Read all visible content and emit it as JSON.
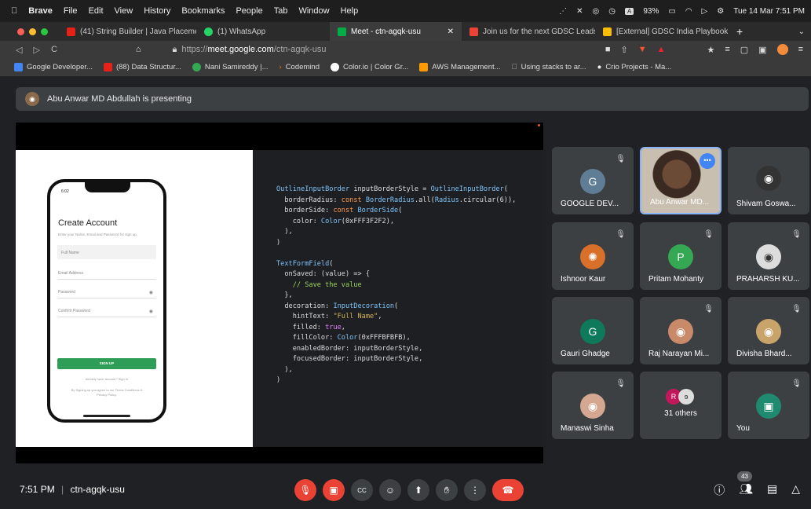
{
  "menubar": {
    "browser": "Brave",
    "items": [
      "File",
      "Edit",
      "View",
      "History",
      "Bookmarks",
      "People",
      "Tab",
      "Window",
      "Help"
    ],
    "battery": "93%",
    "datetime": "Tue 14 Mar 7:51 PM"
  },
  "tabs": [
    {
      "label": "(41) String Builder | Java Placemen",
      "color": "#e62117"
    },
    {
      "label": "(1) WhatsApp",
      "color": "#25d366"
    },
    {
      "label": "Meet - ctn-agqk-usu",
      "color": "#00ac47",
      "active": true
    },
    {
      "label": "Join us for the next GDSC Leads Sy",
      "color": "#ea4335"
    },
    {
      "label": "[External] GDSC India Playbook 20:",
      "color": "#fbbc04"
    }
  ],
  "address": {
    "scheme": "https://",
    "host": "meet.google.com",
    "path": "/ctn-agqk-usu"
  },
  "bookmarks": [
    {
      "label": "Google Developer...",
      "color": "#4285f4"
    },
    {
      "label": "(88) Data Structur...",
      "color": "#e62117"
    },
    {
      "label": "Nani Samireddy |...",
      "color": "#34a853"
    },
    {
      "label": "Codemind",
      "color": "#f26522"
    },
    {
      "label": "Color.io | Color Gr...",
      "color": "#ffffff"
    },
    {
      "label": "AWS Management...",
      "color": "#ff9900"
    },
    {
      "label": "Using stacks to ar...",
      "color": "#888888"
    },
    {
      "label": "Crio Projects - Ma...",
      "color": "#dddddd"
    }
  ],
  "presenting": {
    "name": "Abu Anwar MD Abdullah is presenting"
  },
  "phone": {
    "time": "6:02",
    "title": "Create Account",
    "subtitle": "Enter your Name, Email and Password for sign up.",
    "fields": [
      "Full Name",
      "Email Address",
      "Password",
      "Confirm Password"
    ],
    "button": "SIGN UP",
    "login": "Already have account? Sign In",
    "terms": "By Signing up you agree to our Terms Conditions & Privacy Policy."
  },
  "code": {
    "l1a": "OutlineInputBorder",
    "l1b": " inputBorderStyle = ",
    "l1c": "OutlineInputBorder",
    "l1d": "(",
    "l2a": "  borderRadius: ",
    "l2b": "const ",
    "l2c": "BorderRadius",
    "l2d": ".all(",
    "l2e": "Radius",
    "l2f": ".circular(6)),",
    "l3a": "  borderSide: ",
    "l3b": "const ",
    "l3c": "BorderSide",
    "l3d": "(",
    "l4a": "    color: ",
    "l4b": "Color",
    "l4c": "(0xFFF3F2F2),",
    "l5": "  ),",
    "l6": ")",
    "l7": "",
    "l8a": "TextFormField",
    "l8b": "(",
    "l9a": "  onSaved: (value) => {",
    "l10": "    // Save the value",
    "l11": "  },",
    "l12a": "  decoration: ",
    "l12b": "InputDecoration",
    "l12c": "(",
    "l13a": "    hintText: ",
    "l13b": "\"Full Name\"",
    "l13c": ",",
    "l14a": "    filled: ",
    "l14b": "true",
    "l14c": ",",
    "l15a": "    fillColor: ",
    "l15b": "Color",
    "l15c": "(0xFFFBFBFB),",
    "l16": "    enabledBorder: inputBorderStyle,",
    "l17": "    focusedBorder: inputBorderStyle,",
    "l18": "  ),",
    "l19": ")"
  },
  "participants": [
    {
      "name": "GOOGLE DEV...",
      "initial": "G",
      "color": "#5f7d95"
    },
    {
      "name": "Abu Anwar MD...",
      "initial": "",
      "color": "#8a6a4a",
      "active": true
    },
    {
      "name": "Shivam Goswa...",
      "initial": "",
      "color": "#333333"
    },
    {
      "name": "Ishnoor Kaur",
      "initial": "",
      "color": "#d9702a"
    },
    {
      "name": "Pritam Mohanty",
      "initial": "P",
      "color": "#34a853"
    },
    {
      "name": "PRAHARSH KU...",
      "initial": "",
      "color": "#dddddd"
    },
    {
      "name": "Gauri Ghadge",
      "initial": "G",
      "color": "#0f7a5b"
    },
    {
      "name": "Raj Narayan Mi...",
      "initial": "",
      "color": "#c98a6a"
    },
    {
      "name": "Divisha Bhard...",
      "initial": "",
      "color": "#c9a46a"
    },
    {
      "name": "Manaswi Sinha",
      "initial": "",
      "color": "#d4a890"
    },
    {
      "name": "31 others",
      "initial": "R",
      "color": "#c2185b"
    },
    {
      "name": "You",
      "initial": "",
      "color": "#1f8a70"
    }
  ],
  "controls": {
    "time": "7:51 PM",
    "separator": "|",
    "meeting": "ctn-agqk-usu",
    "count": "43"
  }
}
